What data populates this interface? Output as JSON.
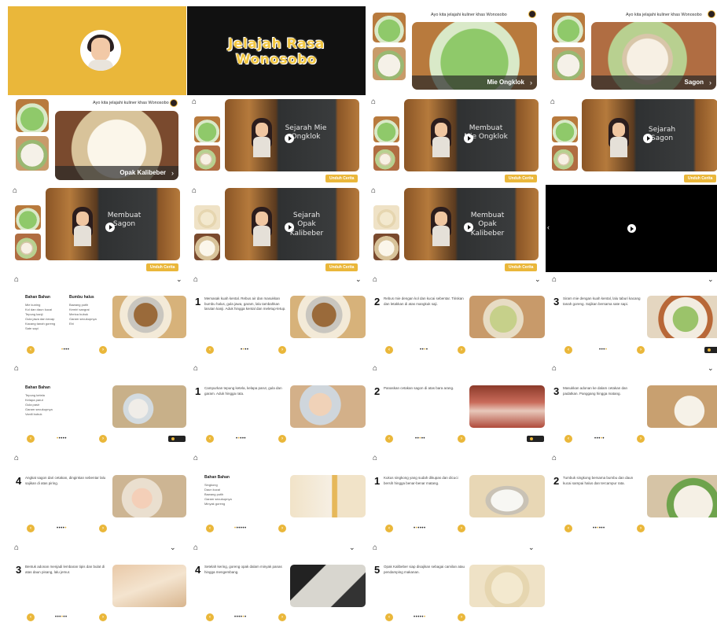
{
  "app": {
    "title": "Jelajah Rasa Wonosobo",
    "header_text": "Ayo kita jelajahi kuliner khas Wonosobo",
    "download_label": "Unduh Cerita"
  },
  "menu": {
    "items": [
      {
        "label": "Mie Ongklok"
      },
      {
        "label": "Sagon"
      },
      {
        "label": "Opak Kalibeber"
      }
    ]
  },
  "videos": [
    {
      "board": "Sejarah Mie Ongklok"
    },
    {
      "board": "Membuat Mie Ongklok"
    },
    {
      "board": "Sejarah Sagon"
    },
    {
      "board": "Membuat Sagon"
    },
    {
      "board": "Sejarah Opak Kalibeber"
    },
    {
      "board": "Membuat Opak Kalibeber"
    }
  ],
  "mie": {
    "ingredients_title": "Bahan Bahan",
    "ingredients_list": "Mie kuning\nKol dan daun kucai\nTepung kanji\nGula jawa dan kecap\nKacang tanah goreng\nSate sapi",
    "spices_title": "Bumbu halus",
    "spices_list": "Bawang putih\nKemiri sangrai\nMerica bubuk\nGaram secukupnya\nEbi",
    "steps": [
      {
        "num": "1",
        "text": "Memasak kuah kental. Rebus air dan masukkan bumbu halus, gula jawa, garam, lalu tambahkan larutan kanji. Aduk hingga kental dan meletup-letup."
      },
      {
        "num": "2",
        "text": "Rebus mie dengan kol dan kucai sebentar. Tiriskan dan letakkan di atas mangkuk saji."
      },
      {
        "num": "3",
        "text": "Siram mie dengan kuah kental, lalu taburi kacang tanah goreng. Sajikan bersama sate sapi."
      }
    ]
  },
  "sagon": {
    "ingredients_title": "Bahan Bahan",
    "ingredients_list": "Tepung ketela\nKelapa parut\nGula pasir\nGaram secukupnya\nVanili bubuk",
    "steps": [
      {
        "num": "1",
        "text": "Campurkan tepung ketela, kelapa parut, gula dan garam. Aduk hingga rata."
      },
      {
        "num": "2",
        "text": "Panaskan cetakan sagon di atas bara arang."
      },
      {
        "num": "3",
        "text": "Masukkan adonan ke dalam cetakan dan padatkan. Panggang hingga matang."
      },
      {
        "num": "4",
        "text": "Angkat sagon dari cetakan, dinginkan sebentar lalu sajikan di atas piring."
      }
    ]
  },
  "opak": {
    "ingredients_title": "Bahan Bahan",
    "ingredients_list": "Singkong\nDaun kucai\nBawang putih\nGaram secukupnya\nMinyak goreng",
    "steps": [
      {
        "num": "1",
        "text": "Kukus singkong yang sudah dikupas dan dicuci bersih hingga benar-benar matang."
      },
      {
        "num": "2",
        "text": "Tumbuk singkong bersama bumbu dan daun kucai sampai halus dan tercampur rata."
      },
      {
        "num": "3",
        "text": "Bentuk adonan menjadi lembaran tipis dan bulat di atas daun pisang, lalu jemur."
      },
      {
        "num": "4",
        "text": "Setelah kering, goreng opak dalam minyak panas hingga mengembang."
      },
      {
        "num": "5",
        "text": "Opak Kalibeber siap disajikan sebagai camilan atau pendamping makanan."
      }
    ]
  },
  "icons": {
    "home": "home-icon",
    "chevron": "chevron-down-icon",
    "play": "play-icon",
    "prev": "arrow-left-icon",
    "next": "arrow-right-icon"
  },
  "colors": {
    "accent": "#eab73a",
    "dark": "#111111"
  }
}
